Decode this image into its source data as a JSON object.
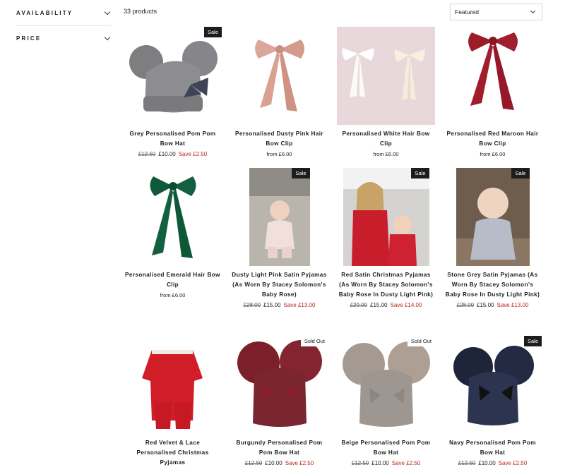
{
  "filters": [
    {
      "label": "AVAILABILITY"
    },
    {
      "label": "PRICE"
    }
  ],
  "toolbar": {
    "count": "33 products",
    "sort_value": "Featured"
  },
  "products": [
    {
      "title": "Grey Personalised Pom Pom Bow Hat",
      "badge": "Sale",
      "was": "£12.50",
      "now": "£10.00",
      "save": "Save £2.50",
      "image": "grey-pom-pom-hat"
    },
    {
      "title": "Personalised Dusty Pink Hair Bow Clip",
      "badge": "",
      "from": "from £6.00",
      "image": "dusty-pink-bow"
    },
    {
      "title": "Personalised White Hair Bow Clip",
      "badge": "",
      "from": "from £6.00",
      "image": "white-bows"
    },
    {
      "title": "Personalised Red Maroon Hair Bow Clip",
      "badge": "",
      "from": "from £6.00",
      "image": "red-maroon-bow"
    },
    {
      "title": "Personalised Emerald Hair Bow Clip",
      "badge": "",
      "from": "from £6.00",
      "image": "emerald-bow"
    },
    {
      "title": "Dusty Light Pink Satin Pyjamas (As Worn By Stacey Solomon's Baby Rose)",
      "badge": "Sale",
      "was": "£28.00",
      "now": "£15.00",
      "save": "Save £13.00",
      "image": "baby-pink-pyjamas"
    },
    {
      "title": "Red Satin Christmas Pyjamas (As Worn By Stacey Solomon's Baby Rose In Dusty Light Pink)",
      "badge": "Sale",
      "was": "£29.00",
      "now": "£15.00",
      "save": "Save £14.00",
      "image": "red-christmas-pyjamas"
    },
    {
      "title": "Stone Grey Satin Pyjamas (As Worn By Stacey Solomon's Baby Rose In Dusty Light Pink)",
      "badge": "Sale",
      "was": "£28.00",
      "now": "£15.00",
      "save": "Save £13.00",
      "image": "grey-satin-pyjamas"
    },
    {
      "title": "Red Velvet & Lace Personalised Christmas Pyjamas",
      "badge": "",
      "image": "red-velvet-pyjamas"
    },
    {
      "title": "Burgundy Personalised Pom Pom Bow Hat",
      "badge": "Sold Out",
      "was": "£12.50",
      "now": "£10.00",
      "save": "Save £2.50",
      "image": "burgundy-pom-hat"
    },
    {
      "title": "Beige Personalised Pom Pom Bow Hat",
      "badge": "Sold Out",
      "was": "£12.50",
      "now": "£10.00",
      "save": "Save £2.50",
      "image": "beige-pom-hat"
    },
    {
      "title": "Navy Personalised Pom Pom Bow Hat",
      "badge": "Sale",
      "was": "£12.50",
      "now": "£10.00",
      "save": "Save £2.50",
      "image": "navy-pom-hat"
    }
  ],
  "icons": {
    "dropdown": "chevron-down-icon"
  },
  "colors": {
    "sale_text": "#b8291b",
    "badge_bg": "#1c1d1d"
  }
}
